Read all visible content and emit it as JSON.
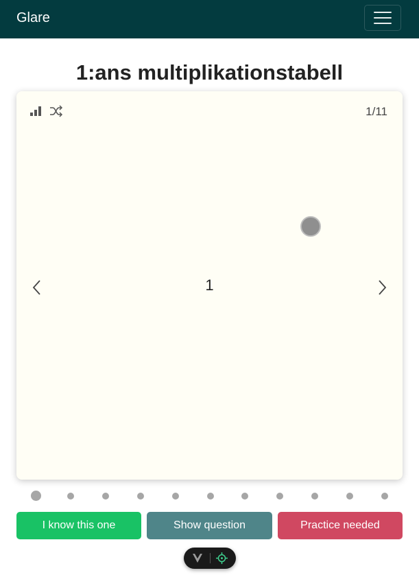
{
  "navbar": {
    "brand": "Glare",
    "menu_icon": "hamburger-icon"
  },
  "page": {
    "title": "1:ans multiplikationstabell"
  },
  "card": {
    "stats_icon": "bar-chart-icon",
    "shuffle_icon": "shuffle-icon",
    "counter": "1/11",
    "content": "1",
    "prev_icon": "chevron-left-icon",
    "next_icon": "chevron-right-icon"
  },
  "pagination": {
    "total": 11,
    "active_index": 0
  },
  "actions": {
    "know": "I know this one",
    "show": "Show question",
    "practice": "Practice needed"
  },
  "devtools": {
    "left_icon": "vue-logo-icon",
    "right_icon": "crosshair-icon"
  },
  "colors": {
    "navbar": "#033b3f",
    "card_bg": "#fffef5",
    "know": "#19c265",
    "show": "#4f8589",
    "practice": "#d04861"
  }
}
